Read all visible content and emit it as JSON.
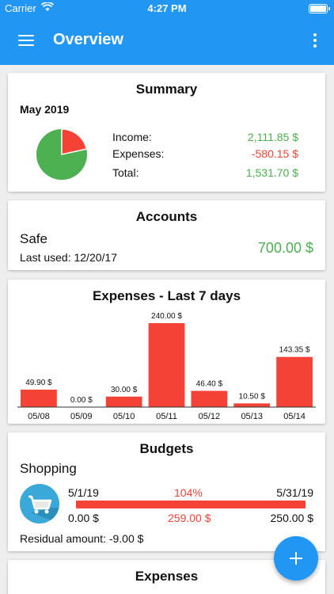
{
  "status_bar": {
    "carrier": "Carrier",
    "time": "4:27 PM"
  },
  "app_bar": {
    "title": "Overview"
  },
  "summary": {
    "title": "Summary",
    "month": "May 2019",
    "income_label": "Income:",
    "income_value": "2,111.85 $",
    "expenses_label": "Expenses:",
    "expenses_value": "-580.15 $",
    "total_label": "Total:",
    "total_value": "1,531.70 $",
    "pie": {
      "income": 2111.85,
      "expenses": 580.15,
      "income_color": "#4caf50",
      "expenses_color": "#f44336"
    }
  },
  "accounts": {
    "title": "Accounts",
    "name": "Safe",
    "last_used": "Last used: 12/20/17",
    "amount": "700.00 $"
  },
  "expenses_chart": {
    "title": "Expenses - Last 7 days"
  },
  "chart_data": {
    "type": "bar",
    "title": "Expenses - Last 7 days",
    "categories": [
      "05/08",
      "05/09",
      "05/10",
      "05/11",
      "05/12",
      "05/13",
      "05/14"
    ],
    "values": [
      49.9,
      0.0,
      30.0,
      240.0,
      46.4,
      10.5,
      143.35
    ],
    "data_labels": [
      "49.90 $",
      "0.00 $",
      "30.00 $",
      "240.00 $",
      "46.40 $",
      "10.50 $",
      "143.35 $"
    ],
    "ylim": [
      0,
      240
    ],
    "bar_color": "#f44336",
    "grid": false
  },
  "budgets": {
    "title": "Budgets",
    "name": "Shopping",
    "start_date": "5/1/19",
    "percent": "104%",
    "end_date": "5/31/19",
    "min": "0.00 $",
    "spent": "259.00 $",
    "max": "250.00 $",
    "progress": 1.0,
    "residual": "Residual amount: -9.00 $"
  },
  "expenses_section": {
    "title": "Expenses"
  },
  "colors": {
    "primary": "#2196f3",
    "positive": "#4caf50",
    "negative": "#f44336"
  }
}
